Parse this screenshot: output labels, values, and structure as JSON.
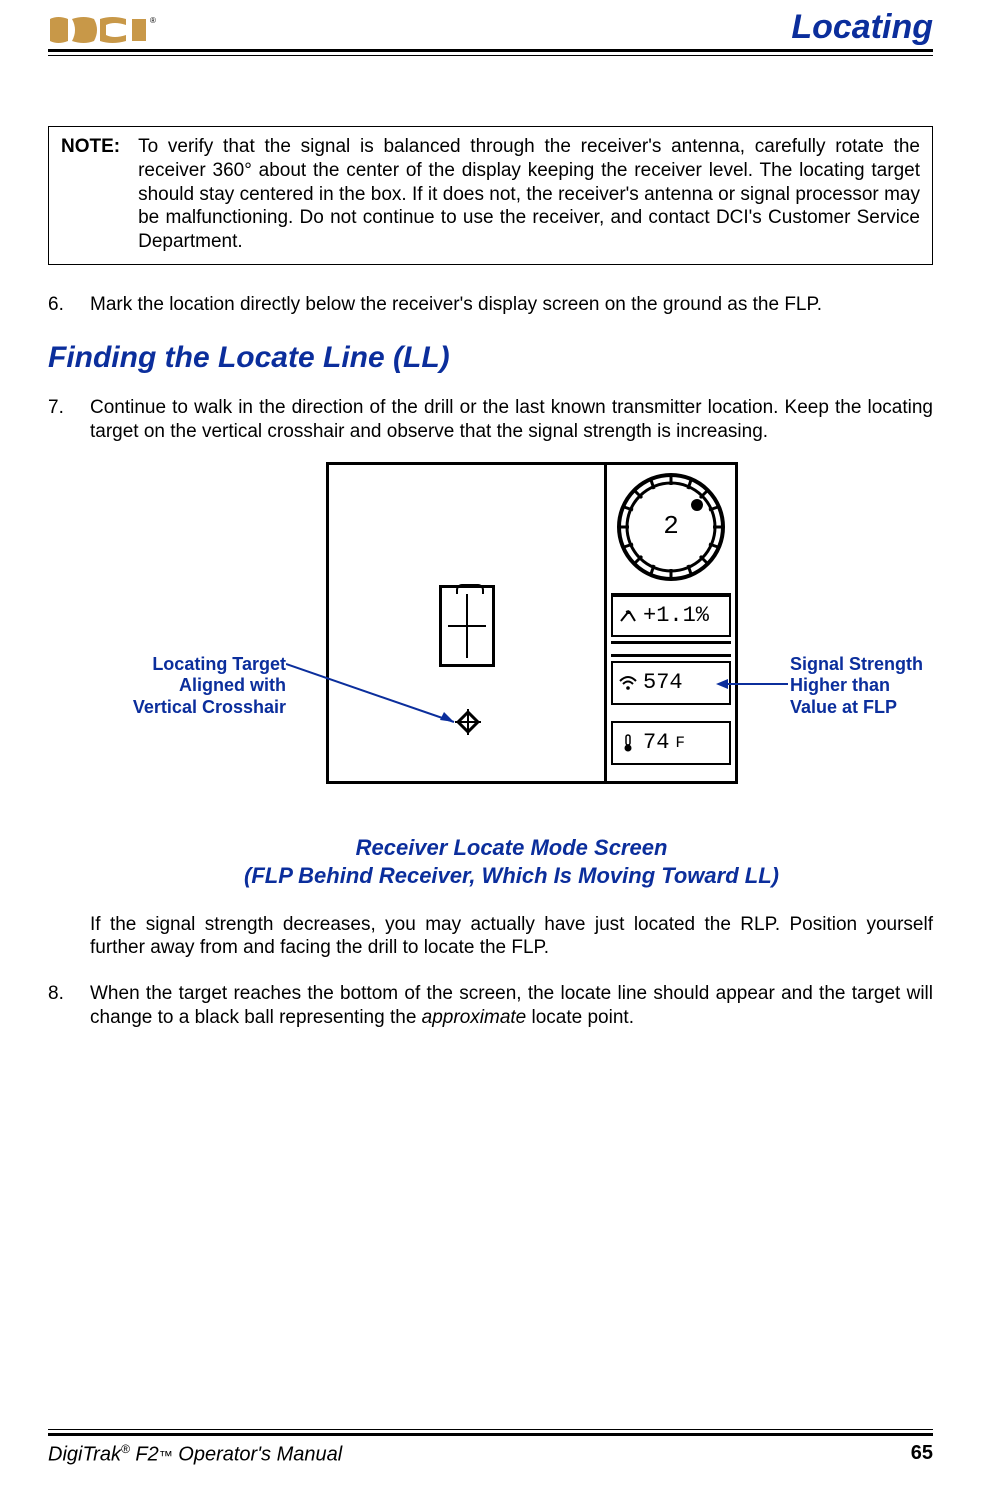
{
  "header": {
    "logo_alt": "DCI",
    "section": "Locating"
  },
  "note": {
    "label": "NOTE:",
    "text": "To verify that the signal is balanced through the receiver's antenna, carefully rotate the receiver 360° about the center of the display keeping the receiver level. The locating target should stay centered in the box. If it does not, the receiver's antenna or signal processor may be malfunctioning. Do not continue to use the receiver, and contact DCI's Customer Service Department."
  },
  "steps": {
    "six": {
      "num": "6.",
      "text": "Mark the location directly below the receiver's display screen on the ground as the FLP."
    },
    "heading": "Finding the Locate Line (LL)",
    "seven": {
      "num": "7.",
      "text": "Continue to walk in the direction of the drill or the last known transmitter location. Keep the locating target on the vertical crosshair and observe that the signal strength is increasing."
    },
    "seven_followup": "If the signal strength decreases, you may actually have just located the RLP. Position yourself further away from and facing the drill to locate the FLP.",
    "eight": {
      "num": "8.",
      "text_before": "When the target reaches the bottom of the screen, the locate line should appear and the target will change to a black ball representing the ",
      "approx_word": "approximate",
      "text_after": " locate point."
    }
  },
  "figure": {
    "clock_position": "2",
    "pitch_value": "+1.1%",
    "signal_value": "574",
    "temp_value": "74",
    "temp_unit": "F",
    "callout_left_l1": "Locating Target",
    "callout_left_l2": "Aligned with",
    "callout_left_l3": "Vertical Crosshair",
    "callout_right_l1": "Signal Strength",
    "callout_right_l2": "Higher than",
    "callout_right_l3": "Value at FLP",
    "caption_l1": "Receiver Locate Mode Screen",
    "caption_l2": "(FLP Behind Receiver, Which Is Moving Toward LL)"
  },
  "footer": {
    "product_pre": "DigiTrak",
    "reg": "®",
    "product_mid": " F2",
    "tm": "™",
    "product_post": " Operator's Manual",
    "page": "65"
  }
}
